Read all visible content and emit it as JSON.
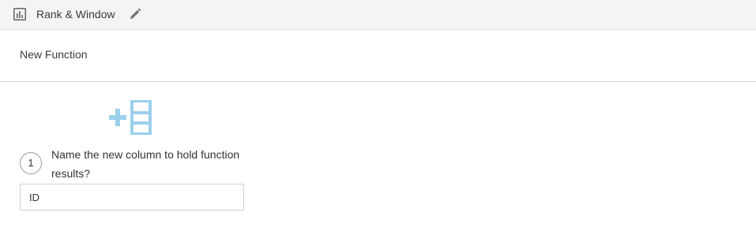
{
  "header": {
    "title": "Rank & Window",
    "chart_icon": "bar-chart-icon",
    "edit_icon": "pencil-icon"
  },
  "section": {
    "title": "New Function"
  },
  "illustration": {
    "icon": "add-column-icon",
    "color": "#9ccfec"
  },
  "step": {
    "number": "1",
    "question": "Name the new column to hold function results?",
    "input_value": "ID",
    "input_placeholder": ""
  }
}
